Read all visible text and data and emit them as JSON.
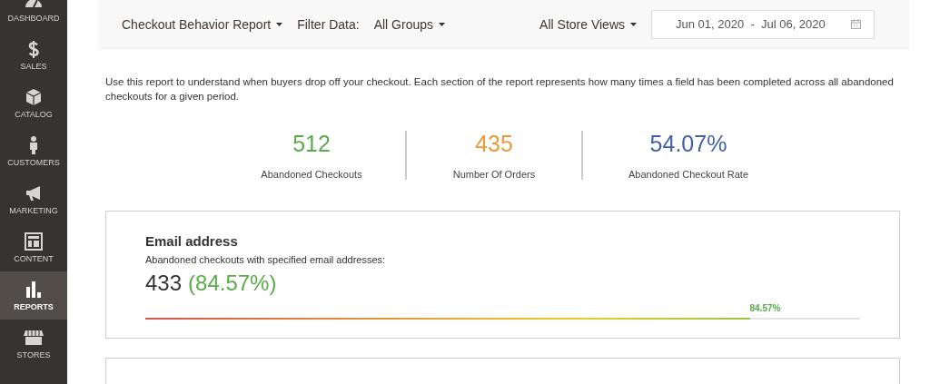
{
  "sidebar": {
    "items": [
      {
        "label": "DASHBOARD",
        "selected": false
      },
      {
        "label": "SALES",
        "selected": false
      },
      {
        "label": "CATALOG",
        "selected": false
      },
      {
        "label": "CUSTOMERS",
        "selected": false
      },
      {
        "label": "MARKETING",
        "selected": false
      },
      {
        "label": "CONTENT",
        "selected": false
      },
      {
        "label": "REPORTS",
        "selected": true
      },
      {
        "label": "STORES",
        "selected": false
      }
    ]
  },
  "toolbar": {
    "report": "Checkout Behavior Report",
    "filter_label": "Filter Data:",
    "group": "All Groups",
    "store_view": "All Store Views",
    "date_from": "Jun 01, 2020",
    "date_separator": "-",
    "date_to": "Jul 06, 2020"
  },
  "description": "Use this report to understand when buyers drop off your checkout. Each section of the report represents how many times a field has been completed across all abandoned checkouts for a given period.",
  "metrics": [
    {
      "value": "512",
      "label": "Abandoned Checkouts",
      "color": "#5aab4a"
    },
    {
      "value": "435",
      "label": "Number Of Orders",
      "color": "#eb9a3b"
    },
    {
      "value": "54.07%",
      "label": "Abandoned Checkout Rate",
      "color": "#3f5fa6"
    }
  ],
  "sections": [
    {
      "title": "Email address",
      "subtitle": "Abandoned checkouts with specified email addresses:",
      "count": "433",
      "percent": "(84.57%)",
      "level": 0.8457,
      "bar_label": "84.57%"
    }
  ]
}
